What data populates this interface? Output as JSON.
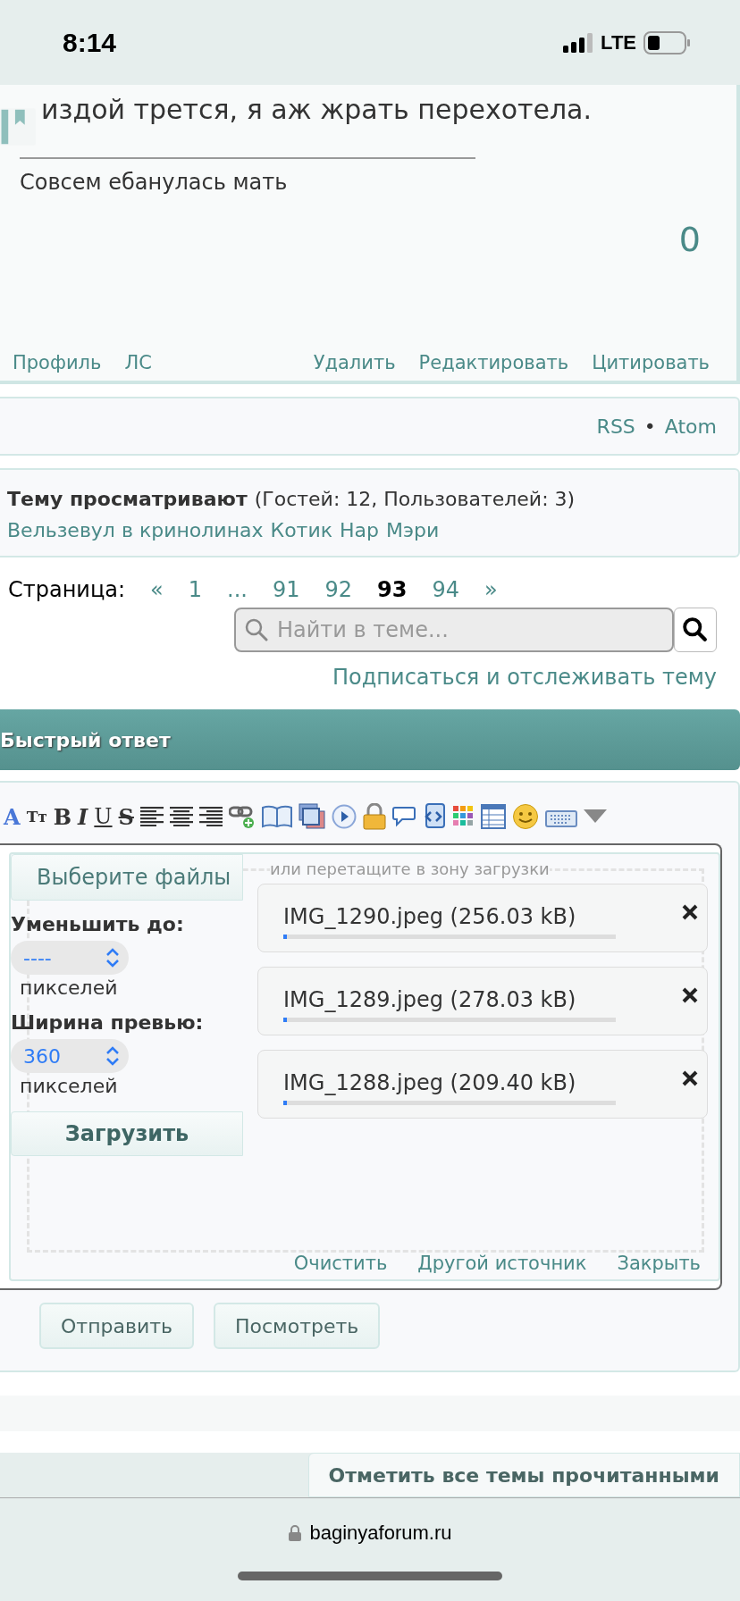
{
  "status_bar": {
    "time": "8:14",
    "network": "LTE"
  },
  "post": {
    "text": "издой трется, я аж жрать перехотела.",
    "signature": "Совсем ебанулась мать",
    "likes": "0",
    "links_left": [
      "Профиль",
      "ЛС"
    ],
    "links_right": [
      "Удалить",
      "Редактировать",
      "Цитировать"
    ]
  },
  "feeds": {
    "links": [
      "RSS",
      "Atom"
    ],
    "separator": "•"
  },
  "viewers": {
    "title": "Тему просматривают",
    "counts": "(Гостей: 12, Пользователей: 3)",
    "users": [
      "Вельзевул в кринолинах",
      "Котик",
      "Нар",
      "Мэри"
    ]
  },
  "pagination": {
    "label": "Страница:",
    "pages": [
      {
        "label": "«",
        "selected": false
      },
      {
        "label": "1",
        "selected": false
      },
      {
        "label": "...",
        "selected": false
      },
      {
        "label": "91",
        "selected": false
      },
      {
        "label": "92",
        "selected": false
      },
      {
        "label": "93",
        "selected": true
      },
      {
        "label": "94",
        "selected": false
      },
      {
        "label": "»",
        "selected": false
      }
    ]
  },
  "search": {
    "placeholder": "Найти в теме..."
  },
  "subscribe": "Подписаться и отслеживать тему",
  "quick_reply": {
    "title": "Быстрый ответ",
    "toolbar": [
      {
        "kind": "font-color",
        "label": "A"
      },
      {
        "kind": "text",
        "label": "Tт"
      },
      {
        "kind": "bold",
        "label": "B"
      },
      {
        "kind": "italic",
        "label": "I"
      },
      {
        "kind": "underline",
        "label": "U"
      },
      {
        "kind": "strike",
        "label": "S"
      },
      {
        "kind": "align-left"
      },
      {
        "kind": "align-center"
      },
      {
        "kind": "align-right"
      },
      {
        "kind": "link"
      },
      {
        "kind": "book"
      },
      {
        "kind": "images"
      },
      {
        "kind": "play"
      },
      {
        "kind": "lock"
      },
      {
        "kind": "speech"
      },
      {
        "kind": "script"
      },
      {
        "kind": "palette"
      },
      {
        "kind": "table"
      },
      {
        "kind": "smiley"
      },
      {
        "kind": "keyboard"
      },
      {
        "kind": "dropdown"
      }
    ],
    "uploader": {
      "choose_button": "Выберите файлы",
      "drop_hint": "или перетащите в зону загрузки",
      "resize_label": "Уменьшить до:",
      "resize_value": "----",
      "resize_unit": "пикселей",
      "preview_label": "Ширина превью:",
      "preview_value": "360",
      "preview_unit": "пикселей",
      "upload_button": "Загрузить",
      "files": [
        {
          "name": "IMG_1290.jpeg (256.03 kB)",
          "level": 0.01
        },
        {
          "name": "IMG_1289.jpeg (278.03 kB)",
          "level": 0.01
        },
        {
          "name": "IMG_1288.jpeg (209.40 kB)",
          "level": 0.01
        }
      ],
      "links": [
        "Очистить",
        "Другой источник",
        "Закрыть"
      ]
    },
    "buttons": [
      "Отправить",
      "Посмотреть"
    ]
  },
  "mark_read": "Отметить все темы прочитанными",
  "address_bar": {
    "url": "baginyaforum.ru"
  }
}
